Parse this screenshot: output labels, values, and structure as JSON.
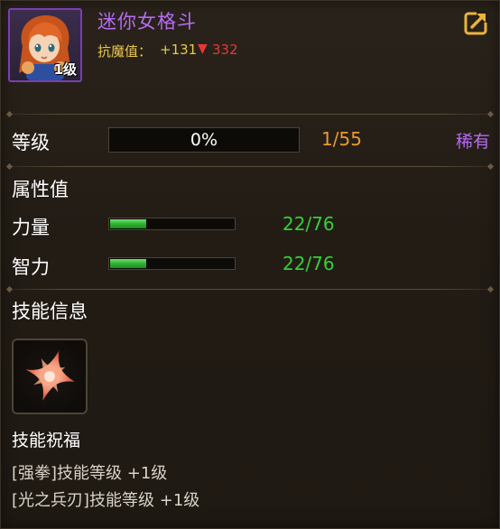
{
  "header": {
    "name": "迷你女格斗",
    "avatar_level": "1级",
    "resist_label": "抗魔值：",
    "resist_increase": "+131",
    "resist_decrease_arrow": "▼",
    "resist_decrease": "332",
    "share_icon": "share-arrow-icon"
  },
  "level": {
    "label": "等级",
    "progress_text": "0%",
    "progress": 0,
    "count": "1/55",
    "rarity": "稀有"
  },
  "attributes": {
    "heading": "属性值",
    "items": [
      {
        "label": "力量",
        "value": "22/76",
        "fraction": 0.29
      },
      {
        "label": "智力",
        "value": "22/76",
        "fraction": 0.29
      }
    ]
  },
  "skills": {
    "heading": "技能信息",
    "icon": "four-point-star-skill-icon",
    "blessing_heading": "技能祝福",
    "lines": [
      "[强拳]技能等级 +1级",
      "[光之兵刃]技能等级 +1级"
    ]
  },
  "colors": {
    "name_purple": "#b46cf0",
    "resist_gold": "#e9c74a",
    "decrease_red": "#e23a3a",
    "count_orange": "#e89b2c",
    "value_green": "#35d136"
  }
}
